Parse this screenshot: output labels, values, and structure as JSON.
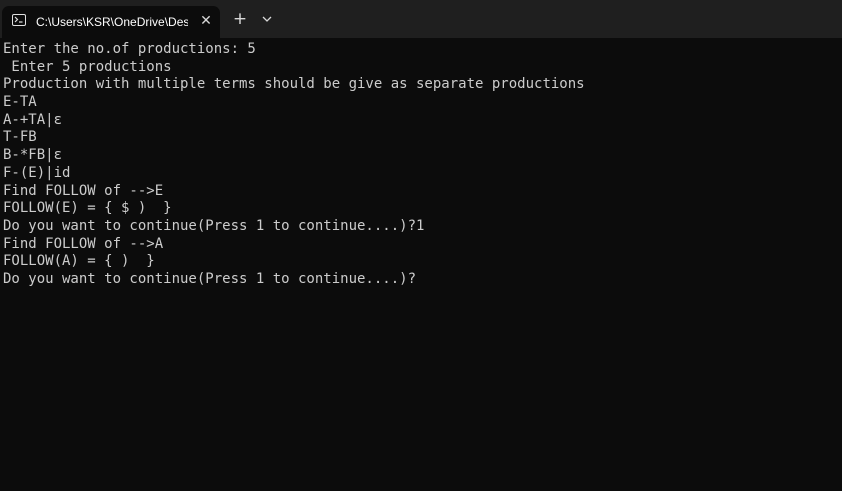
{
  "tab": {
    "title": "C:\\Users\\KSR\\OneDrive\\Desktop",
    "close_glyph": "✕",
    "icon": "terminal-icon"
  },
  "toolbar": {
    "new_tab_glyph": "+",
    "dropdown_icon": "chevron-down-icon"
  },
  "colors": {
    "titlebar": "#1f1f1f",
    "background": "#0c0c0c",
    "text": "#cccccc"
  },
  "terminal": {
    "lines": [
      "Enter the no.of productions: 5",
      " Enter 5 productions",
      "Production with multiple terms should be give as separate productions",
      "E-TA",
      "A-+TA|ε",
      "T-FB",
      "B-*FB|ε",
      "F-(E)|id",
      "Find FOLLOW of -->E",
      "FOLLOW(E) = { $ )  }",
      "Do you want to continue(Press 1 to continue....)?1",
      "Find FOLLOW of -->A",
      "FOLLOW(A) = { )  }",
      "Do you want to continue(Press 1 to continue....)?"
    ]
  }
}
